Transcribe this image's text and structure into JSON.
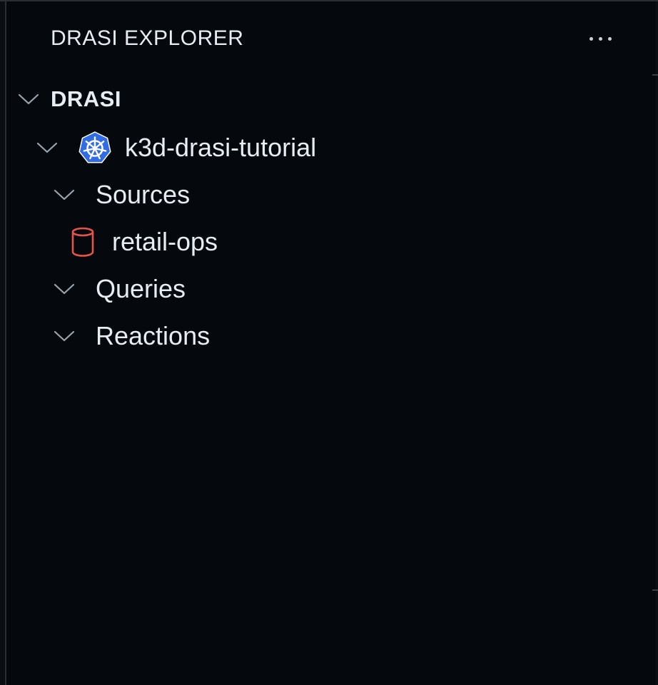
{
  "panel": {
    "title": "DRASI EXPLORER",
    "more_actions_icon": "ellipsis-icon"
  },
  "tree": {
    "section": {
      "label": "DRASI",
      "expanded": true
    },
    "cluster": {
      "label": "k3d-drasi-tutorial",
      "icon": "kubernetes-icon",
      "icon_color": "#326ce5",
      "expanded": true
    },
    "groups": {
      "sources": {
        "label": "Sources",
        "expanded": true,
        "items": [
          {
            "label": "retail-ops",
            "icon": "database-icon",
            "icon_color": "#e5534b"
          }
        ]
      },
      "queries": {
        "label": "Queries",
        "expanded": true
      },
      "reactions": {
        "label": "Reactions",
        "expanded": true
      }
    }
  },
  "colors": {
    "background": "#05080c",
    "text": "#e6edf3",
    "chevron": "#9aa4af"
  }
}
